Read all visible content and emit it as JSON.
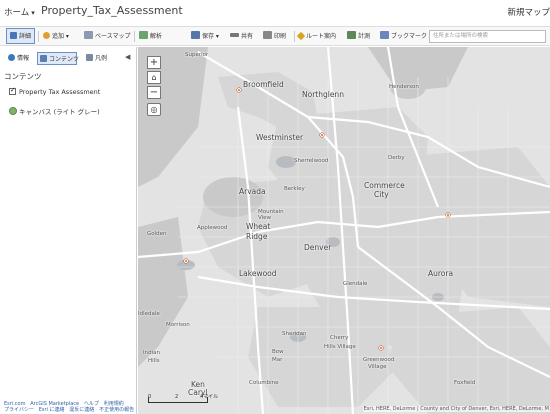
{
  "topbar": {
    "home": "ホーム",
    "title": "Property_Tax_Assessment",
    "new_map": "新規マップ"
  },
  "toolbar": {
    "detail": "詳細",
    "add": "追加",
    "basemap": "ベースマップ",
    "analysis": "解析",
    "save": "保存",
    "share": "共有",
    "print": "印刷",
    "directions": "ルート案内",
    "measure": "計測",
    "bookmarks": "ブックマーク",
    "search_placeholder": "住所または場所の検索"
  },
  "panel": {
    "tabs": [
      {
        "label": "情報",
        "active": false
      },
      {
        "label": "コンテンツ",
        "active": true
      },
      {
        "label": "凡例",
        "active": false
      }
    ],
    "section_title": "コンテンツ",
    "layers": [
      {
        "label": "Property Tax Assessment",
        "checked": true
      }
    ],
    "basemap_label": "キャンバス (ライト グレー)",
    "footer_line1": [
      "Esri.com",
      "ArcGIS Marketplace",
      "ヘルプ",
      "利用規約"
    ],
    "footer_line2": [
      "プライバシー",
      "Esri に連絡",
      "違反に連絡",
      "不正使用の報告"
    ]
  },
  "map": {
    "places": [
      {
        "name": "Superior",
        "size": "s"
      },
      {
        "name": "Broomfield",
        "size": "m"
      },
      {
        "name": "Northglenn",
        "size": "m"
      },
      {
        "name": "Henderson",
        "size": "s"
      },
      {
        "name": "Westminster",
        "size": "m"
      },
      {
        "name": "Sherrelwood",
        "size": "s"
      },
      {
        "name": "Derby",
        "size": "s"
      },
      {
        "name": "Arvada",
        "size": "m"
      },
      {
        "name": "Berkley",
        "size": "s"
      },
      {
        "name": "Commerce",
        "size": "m"
      },
      {
        "name": "City",
        "size": "m"
      },
      {
        "name": "Mountain",
        "size": "s"
      },
      {
        "name": "View",
        "size": "s"
      },
      {
        "name": "Golden",
        "size": "s"
      },
      {
        "name": "Applewood",
        "size": "s"
      },
      {
        "name": "Wheat",
        "size": "m"
      },
      {
        "name": "Ridge",
        "size": "m"
      },
      {
        "name": "Denver",
        "size": "m"
      },
      {
        "name": "Lakewood",
        "size": "m"
      },
      {
        "name": "Aurora",
        "size": "m"
      },
      {
        "name": "Glendale",
        "size": "s"
      },
      {
        "name": "Idledale",
        "size": "s"
      },
      {
        "name": "Morrison",
        "size": "s"
      },
      {
        "name": "Sheridan",
        "size": "s"
      },
      {
        "name": "Cherry",
        "size": "s"
      },
      {
        "name": "Hills Village",
        "size": "s"
      },
      {
        "name": "Indian",
        "size": "s"
      },
      {
        "name": "Hills",
        "size": "s"
      },
      {
        "name": "Bow",
        "size": "s"
      },
      {
        "name": "Mar",
        "size": "s"
      },
      {
        "name": "Greenwood",
        "size": "s"
      },
      {
        "name": "Village",
        "size": "s"
      },
      {
        "name": "Ken",
        "size": "m"
      },
      {
        "name": "Caryl",
        "size": "m"
      },
      {
        "name": "Columbine",
        "size": "s"
      },
      {
        "name": "Foxfield",
        "size": "s"
      }
    ],
    "scale_labels": [
      "0",
      "2",
      "4マイル"
    ],
    "attribution": "Esri, HERE, DeLorme | County and City of Denver, Esri, HERE, DeLorme, M",
    "marker_color": "#e8622a"
  }
}
